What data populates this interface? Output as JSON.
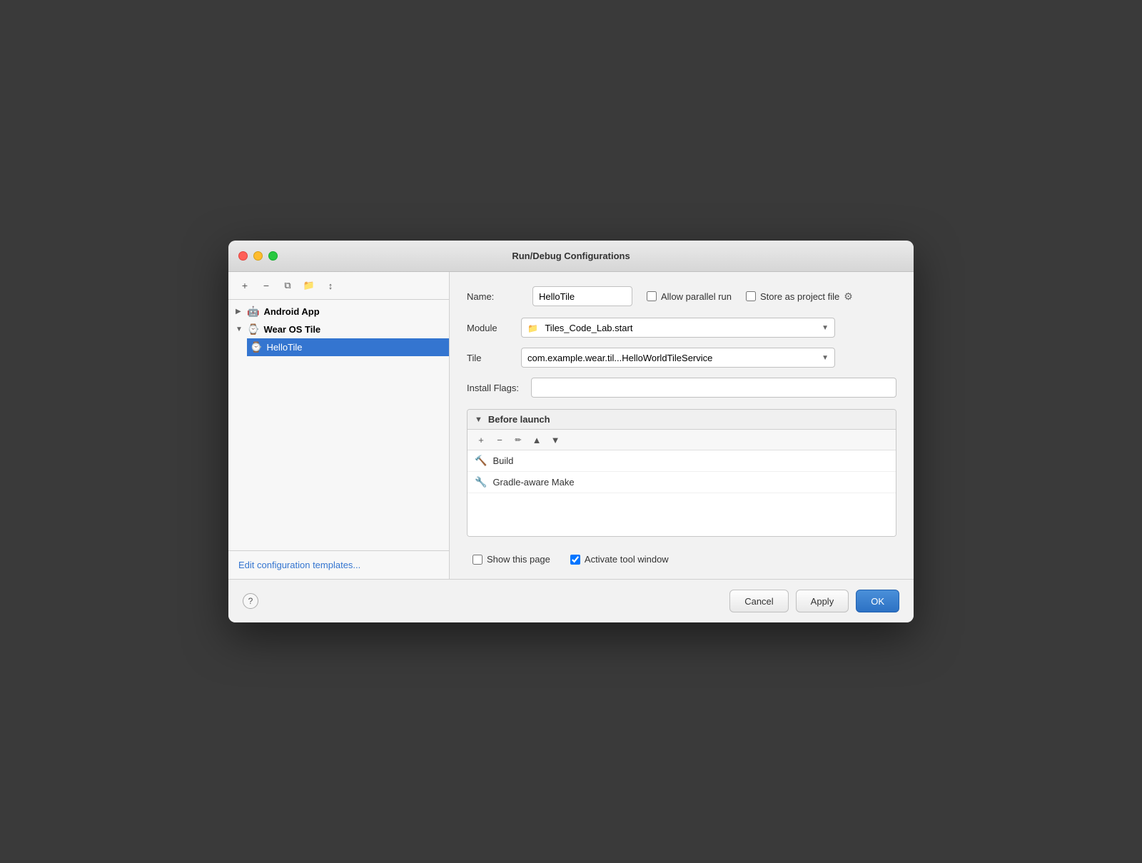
{
  "window": {
    "title": "Run/Debug Configurations"
  },
  "sidebar": {
    "toolbar": {
      "add_label": "+",
      "remove_label": "−",
      "copy_label": "⧉",
      "folder_label": "📁",
      "sort_label": "↕"
    },
    "tree": [
      {
        "id": "android-app",
        "label": "Android App",
        "icon": "🤖",
        "collapsed": true,
        "children": []
      },
      {
        "id": "wear-os-tile",
        "label": "Wear OS Tile",
        "icon": "⌚",
        "collapsed": false,
        "children": [
          {
            "id": "hello-tile",
            "label": "HelloTile",
            "icon": "⌚",
            "selected": true
          }
        ]
      }
    ],
    "footer": {
      "link_label": "Edit configuration templates..."
    }
  },
  "form": {
    "name_label": "Name:",
    "name_value": "HelloTile",
    "allow_parallel_label": "Allow parallel run",
    "allow_parallel_checked": false,
    "store_as_project_label": "Store as project file",
    "store_as_project_checked": false,
    "module_label": "Module",
    "module_value": "Tiles_Code_Lab.start",
    "tile_label": "Tile",
    "tile_value": "com.example.wear.til...HelloWorldTileService",
    "install_flags_label": "Install Flags:",
    "install_flags_value": "",
    "before_launch": {
      "title": "Before launch",
      "toolbar_buttons": [
        "+",
        "−",
        "✏",
        "▲",
        "▼"
      ],
      "items": [
        {
          "icon": "🔨",
          "label": "Build",
          "icon_color": "#4caf50"
        },
        {
          "icon": "🔧",
          "label": "Gradle-aware Make",
          "icon_color": "#4caf50"
        }
      ]
    },
    "show_page_label": "Show this page",
    "show_page_checked": false,
    "activate_tool_label": "Activate tool window",
    "activate_tool_checked": true
  },
  "footer": {
    "help_label": "?",
    "cancel_label": "Cancel",
    "apply_label": "Apply",
    "ok_label": "OK"
  }
}
